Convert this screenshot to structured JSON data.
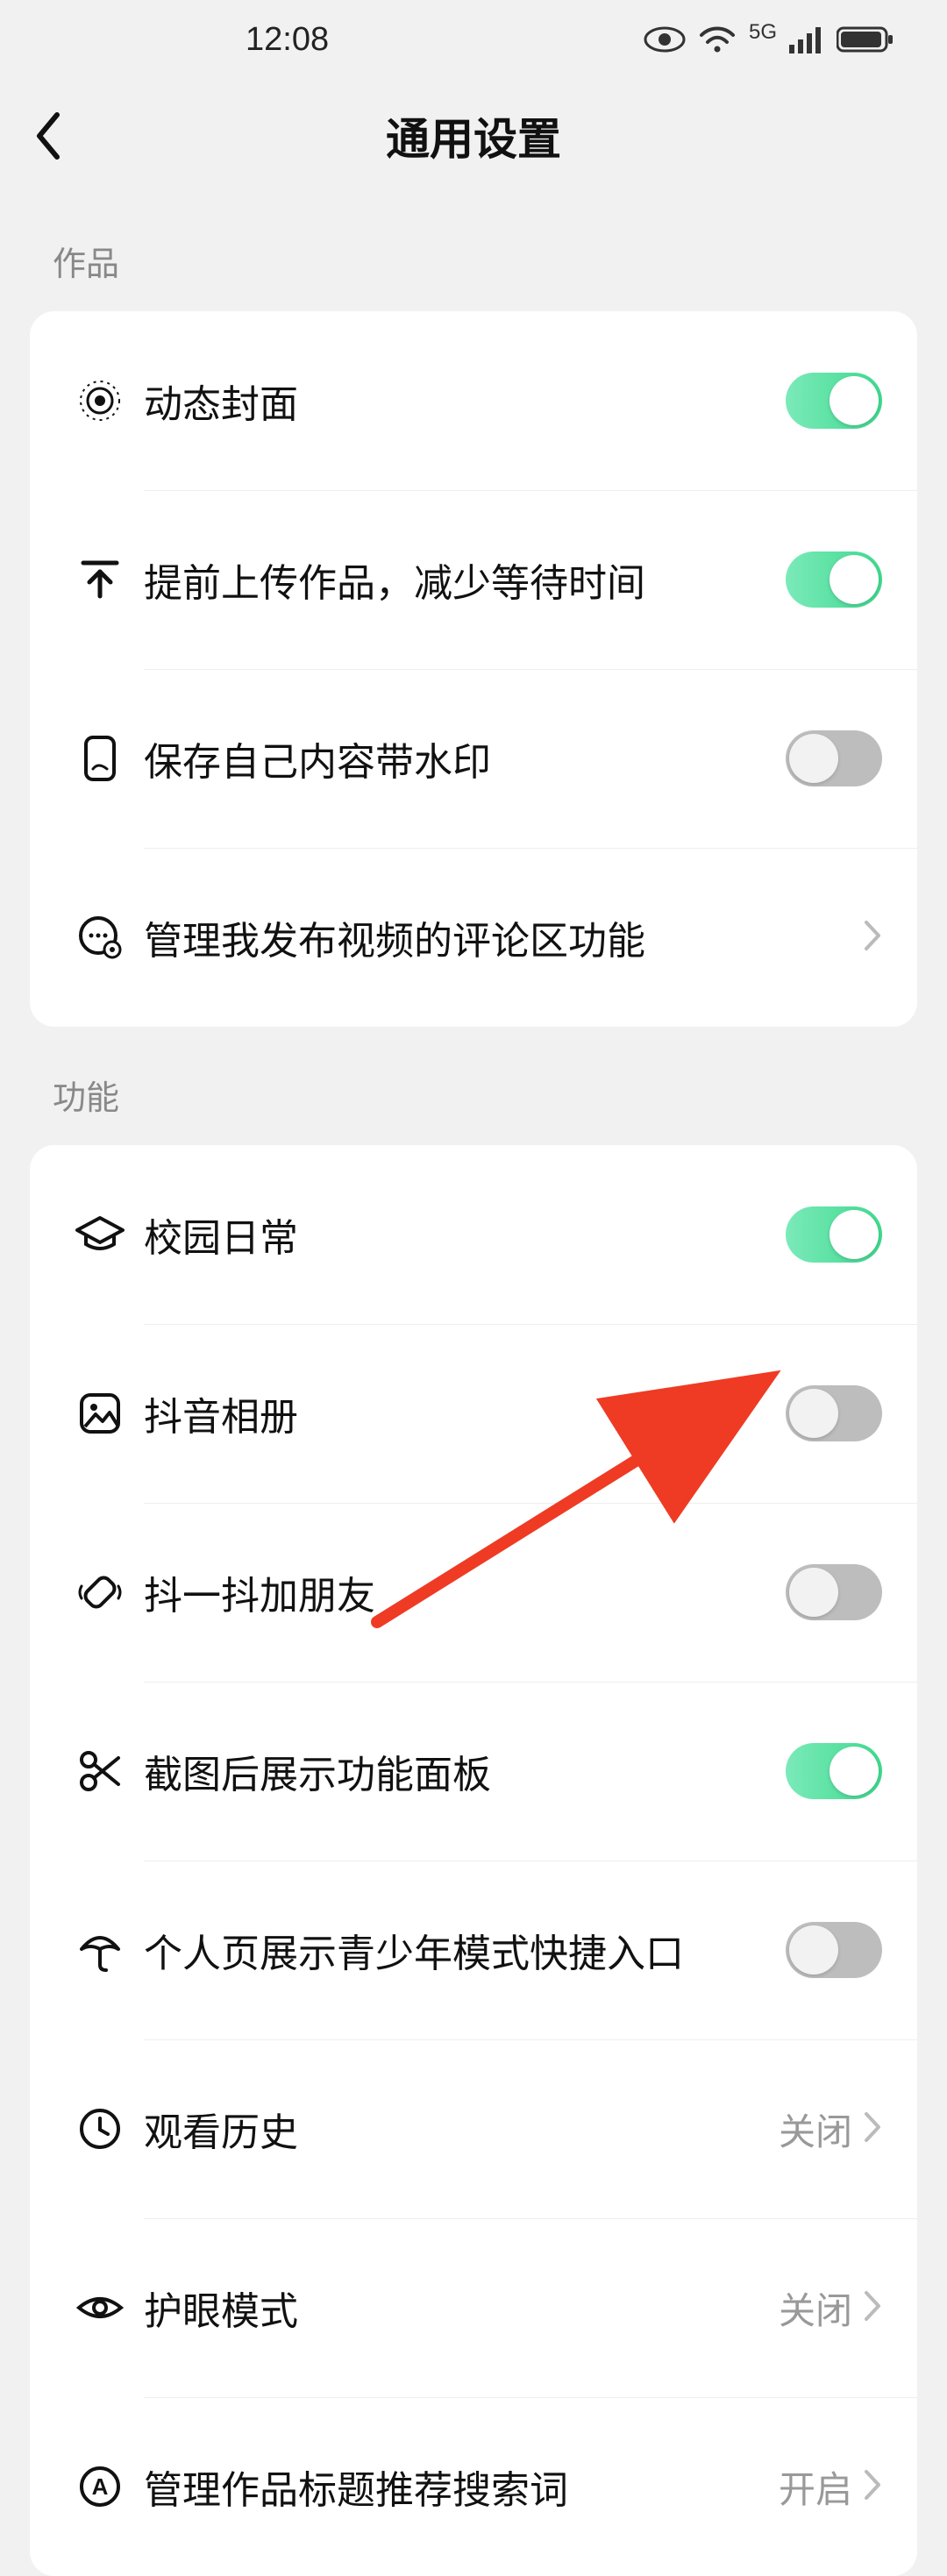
{
  "status": {
    "time": "12:08",
    "network": "5G"
  },
  "header": {
    "title": "通用设置"
  },
  "sections": {
    "works": {
      "label": "作品",
      "items": [
        {
          "label": "动态封面"
        },
        {
          "label": "提前上传作品，减少等待时间"
        },
        {
          "label": "保存自己内容带水印"
        },
        {
          "label": "管理我发布视频的评论区功能"
        }
      ]
    },
    "features": {
      "label": "功能",
      "items": [
        {
          "label": "校园日常"
        },
        {
          "label": "抖音相册"
        },
        {
          "label": "抖一抖加朋友"
        },
        {
          "label": "截图后展示功能面板"
        },
        {
          "label": "个人页展示青少年模式快捷入口"
        },
        {
          "label": "观看历史",
          "value": "关闭"
        },
        {
          "label": "护眼模式",
          "value": "关闭"
        },
        {
          "label": "管理作品标题推荐搜索词",
          "value": "开启"
        }
      ]
    }
  },
  "toggles": {
    "dynamic_cover": true,
    "preupload": true,
    "save_watermark": false,
    "campus_daily": true,
    "douyin_album": false,
    "shake_friend": false,
    "screenshot_panel": true,
    "teen_mode_entry": false
  }
}
